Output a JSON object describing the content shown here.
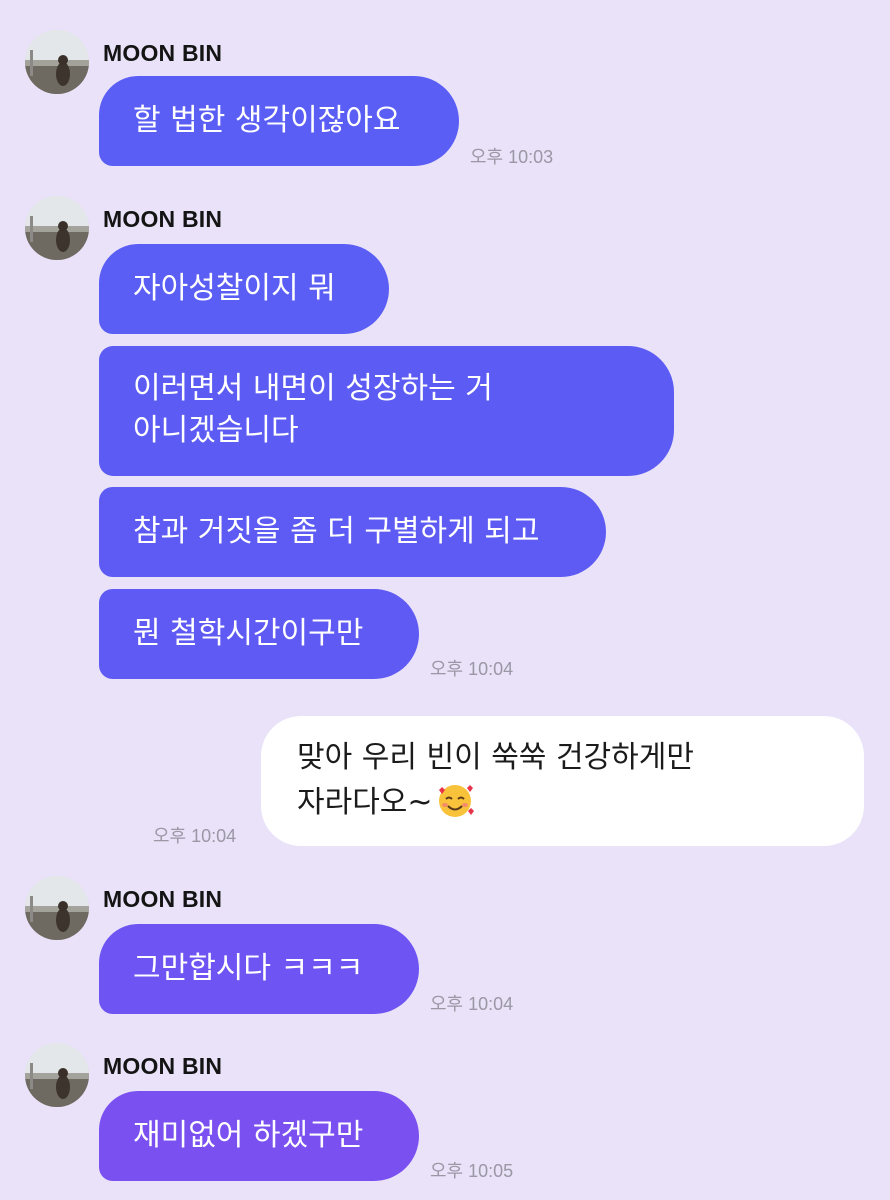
{
  "chat": {
    "groups": [
      {
        "sender": "MOON BIN",
        "messages": [
          "할 법한 생각이잖아요"
        ],
        "time": "오후 10:03"
      },
      {
        "sender": "MOON BIN",
        "messages": [
          "자아성찰이지 뭐",
          "이러면서 내면이 성장하는 거",
          "아니겠습니다",
          "참과 거짓을 좀 더 구별하게 되고",
          "뭔 철학시간이구만"
        ],
        "time": "오후 10:04"
      },
      {
        "mine": true,
        "messages": [
          "맞아 우리 빈이 쑥쑥 건강하게만",
          "자라다오~"
        ],
        "time": "오후 10:04",
        "emoji": "smiling-face-with-hearts"
      },
      {
        "sender": "MOON BIN",
        "messages": [
          "그만합시다 ㅋㅋㅋ"
        ],
        "time": "오후 10:04"
      },
      {
        "sender": "MOON BIN",
        "messages": [
          "재미없어 하겠구만"
        ],
        "time": "오후 10:05"
      }
    ]
  },
  "colors": {
    "background": "#e9e2f8",
    "bubble_blue": "#5b5ef4",
    "bubble_violet": "#7b50f1",
    "my_bubble": "#ffffff",
    "time_text": "#9b97a5"
  }
}
